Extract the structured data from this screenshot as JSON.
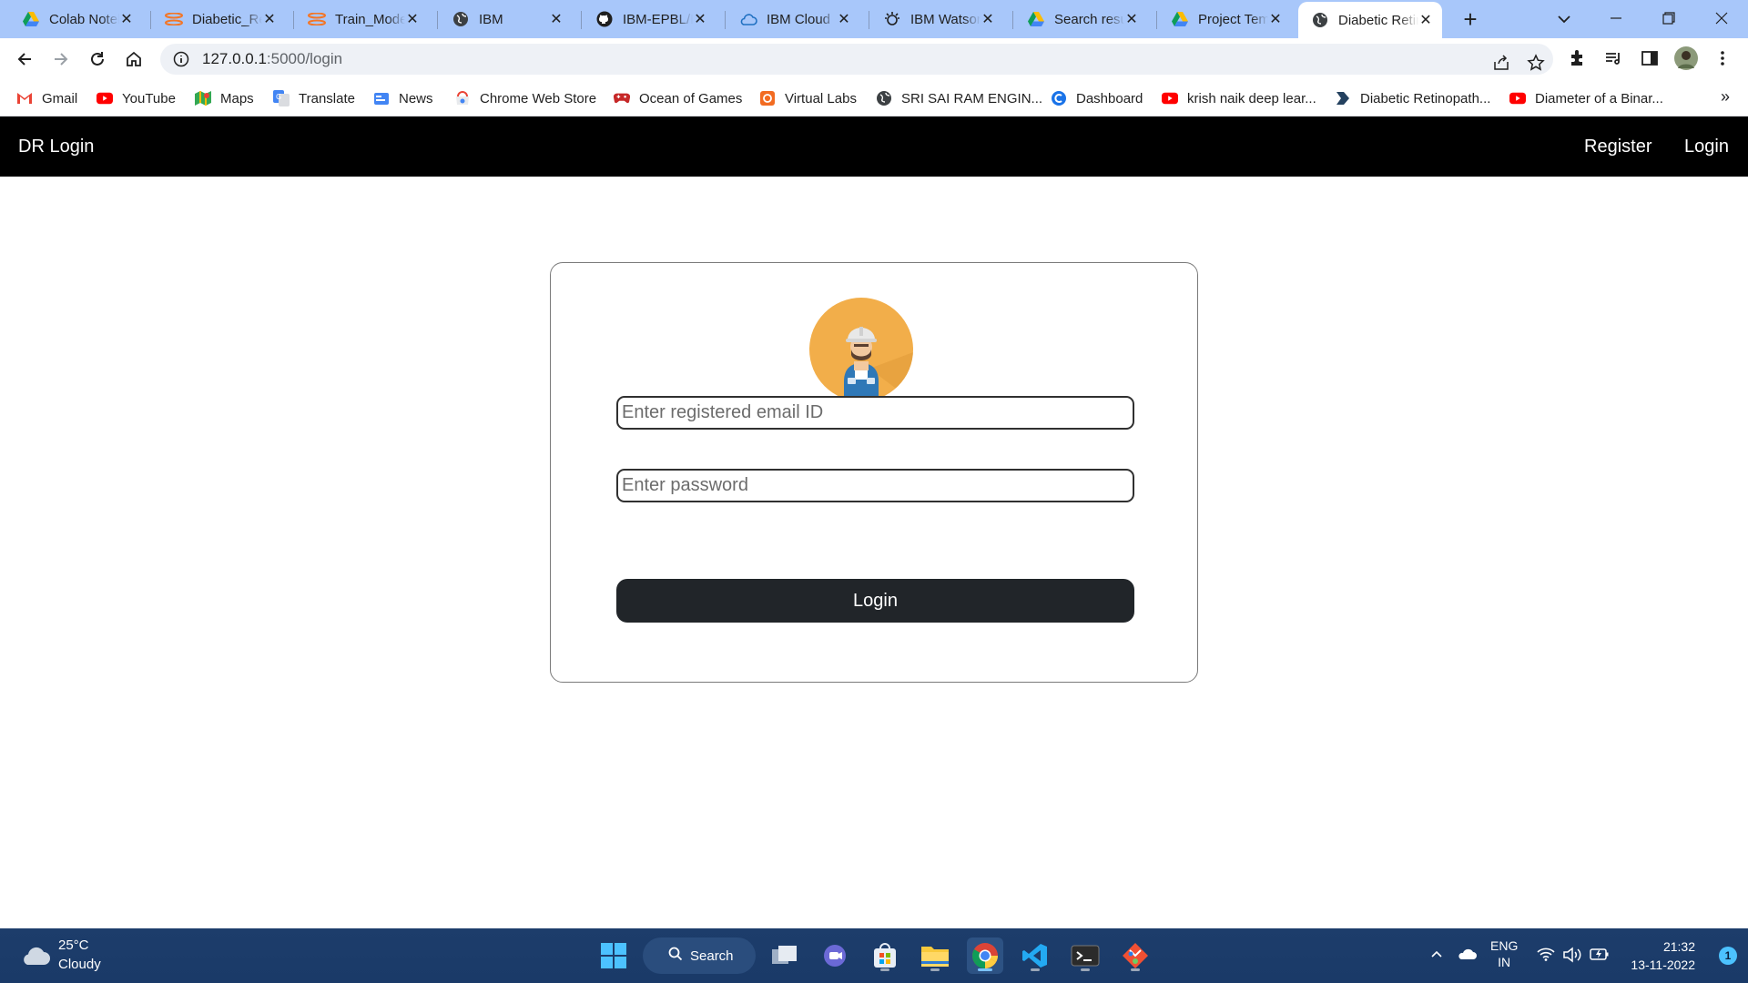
{
  "browser": {
    "tabs": [
      {
        "title": "Colab Notebooks",
        "icon": "google-drive-icon"
      },
      {
        "title": "Diabetic_Retinopathy",
        "icon": "jupyter-icon"
      },
      {
        "title": "Train_Model",
        "icon": "jupyter-icon"
      },
      {
        "title": "IBM",
        "icon": "globe-icon"
      },
      {
        "title": "IBM-EPBL/IBM-Project",
        "icon": "github-icon"
      },
      {
        "title": "IBM Cloud",
        "icon": "ibm-cloud-icon"
      },
      {
        "title": "IBM Watson Studio",
        "icon": "watson-icon"
      },
      {
        "title": "Search results",
        "icon": "google-drive-icon"
      },
      {
        "title": "Project Template",
        "icon": "google-drive-icon"
      },
      {
        "title": "Diabetic Retinopathy",
        "icon": "globe-icon"
      }
    ],
    "active_tab": 9,
    "url_host": "127.0.0.1",
    "url_path": ":5000/login",
    "bookmarks": [
      {
        "label": "Gmail",
        "icon": "gmail-icon"
      },
      {
        "label": "YouTube",
        "icon": "youtube-icon"
      },
      {
        "label": "Maps",
        "icon": "maps-icon"
      },
      {
        "label": "Translate",
        "icon": "translate-icon"
      },
      {
        "label": "News",
        "icon": "news-icon"
      },
      {
        "label": "Chrome Web Store",
        "icon": "webstore-icon"
      },
      {
        "label": "Ocean of Games",
        "icon": "gamepad-icon"
      },
      {
        "label": "Virtual Labs",
        "icon": "virtual-labs-icon"
      },
      {
        "label": "SRI SAI RAM ENGIN...",
        "icon": "globe-icon"
      },
      {
        "label": "Dashboard",
        "icon": "dashboard-icon"
      },
      {
        "label": "krish naik deep lear...",
        "icon": "youtube-icon"
      },
      {
        "label": "Diabetic Retinopath...",
        "icon": "bookmark-icon"
      },
      {
        "label": "Diameter of a Binar...",
        "icon": "youtube-icon"
      }
    ],
    "more_bookmarks": "»"
  },
  "page": {
    "brand": "DR Login",
    "nav": {
      "register": "Register",
      "login": "Login"
    },
    "form": {
      "email_placeholder": "Enter registered email ID",
      "email_value": "",
      "password_placeholder": "Enter password",
      "password_value": "",
      "submit_label": "Login"
    },
    "colors": {
      "navbar": "#000000",
      "button": "#212529",
      "avatar": "#f2ae4a"
    }
  },
  "taskbar": {
    "weather_temp": "25°C",
    "weather_desc": "Cloudy",
    "search_label": "Search",
    "lang_top": "ENG",
    "lang_bottom": "IN",
    "time": "21:32",
    "date": "13-11-2022",
    "notifications": "1"
  }
}
